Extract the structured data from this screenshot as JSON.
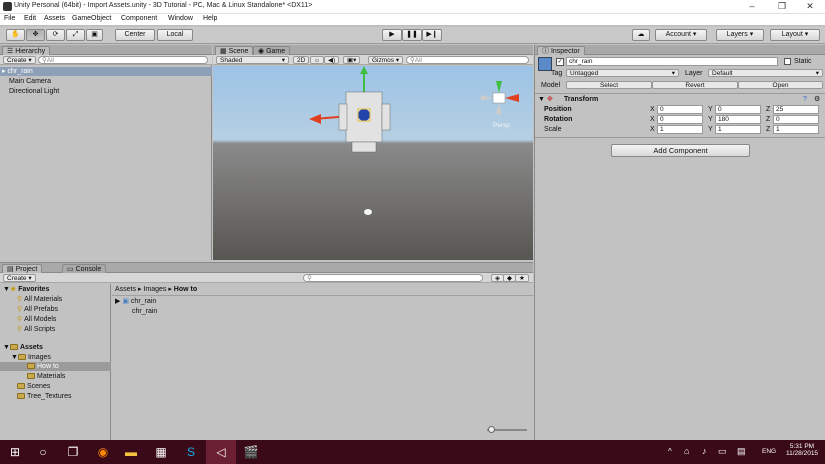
{
  "window": {
    "title": "Unity Personal (64bit) - Import Assets.unity - 3D Tutorial - PC, Mac & Linux Standalone* <DX11>",
    "min": "–",
    "max": "❐",
    "close": "✕"
  },
  "menu": [
    "File",
    "Edit",
    "Assets",
    "GameObject",
    "Component",
    "Window",
    "Help"
  ],
  "toolbar": {
    "center": "Center",
    "local": "Local",
    "account": "Account",
    "layers": "Layers",
    "layout": "Layout",
    "cloud_icon": "cloud-icon"
  },
  "hierarchy": {
    "tab": "Hierarchy",
    "create": "Create",
    "search_placeholder": "All",
    "items": [
      "chr_rain",
      "Main Camera",
      "Directional Light"
    ]
  },
  "scene": {
    "tab_scene": "Scene",
    "tab_game": "Game",
    "shading": "Shaded",
    "mode2d": "2D",
    "gizmos": "Gizmos",
    "search_placeholder": "All",
    "persp": "Persp"
  },
  "project": {
    "tab_project": "Project",
    "tab_console": "Console",
    "create": "Create",
    "favorites_label": "Favorites",
    "favorites": [
      "All Materials",
      "All Prefabs",
      "All Models",
      "All Scripts"
    ],
    "assets_label": "Assets",
    "tree": [
      "Images",
      "How to",
      "Materials",
      "Scenes",
      "Tree_Textures"
    ],
    "breadcrumb": [
      "Assets",
      "Images",
      "How to"
    ],
    "files": [
      "chr_rain",
      "chr_rain"
    ]
  },
  "inspector": {
    "tab": "Inspector",
    "object_name": "chr_rain",
    "static": "Static",
    "tag_label": "Tag",
    "tag_value": "Untagged",
    "layer_label": "Layer",
    "layer_value": "Default",
    "model_label": "Model",
    "select": "Select",
    "revert": "Revert",
    "open": "Open",
    "transform": "Transform",
    "position": {
      "label": "Position",
      "x": "0",
      "y": "0",
      "z": "25"
    },
    "rotation": {
      "label": "Rotation",
      "x": "0",
      "y": "180",
      "z": "0"
    },
    "scale": {
      "label": "Scale",
      "x": "1",
      "y": "1",
      "z": "1"
    },
    "add_component": "Add Component"
  },
  "taskbar": {
    "time": "5:31 PM",
    "date": "11/28/2015",
    "lang": "ENG"
  }
}
